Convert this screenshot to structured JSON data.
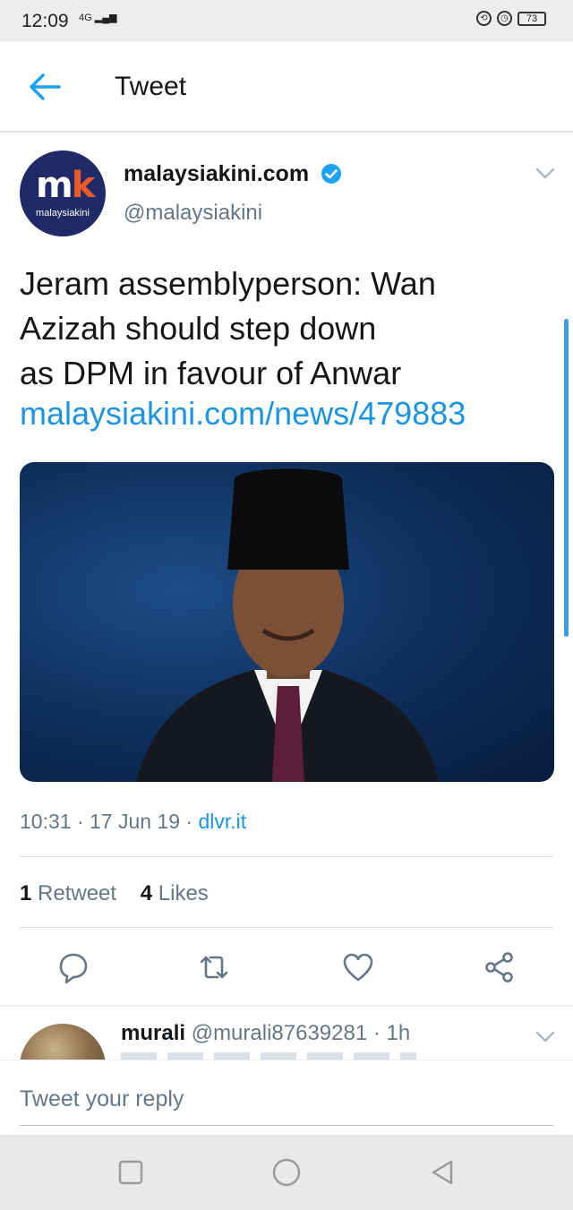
{
  "status_bar": {
    "time": "12:09",
    "network": "4G",
    "battery": "73",
    "icons": [
      "lock-rotation-icon",
      "alarm-icon"
    ]
  },
  "app_bar": {
    "title": "Tweet",
    "back_icon": "arrow-left-icon"
  },
  "tweet": {
    "display_name": "malaysiakini.com",
    "verified": true,
    "handle": "@malaysiakini",
    "avatar_text": "malaysiakini",
    "avatar_logo": {
      "m": "m",
      "k": "k"
    },
    "text_lines": [
      "Jeram assemblyperson: Wan",
      "Azizah should step down",
      "as DPM in favour of Anwar"
    ],
    "link": "malaysiakini.com/news/479883",
    "time": "10:31",
    "date": "17 Jun 19",
    "source": "dlvr.it",
    "retweets_count": "1",
    "retweets_label": "Retweet",
    "likes_count": "4",
    "likes_label": "Likes"
  },
  "actions": [
    "reply-icon",
    "retweet-icon",
    "like-icon",
    "share-icon"
  ],
  "reply": {
    "name": "murali",
    "handle": "@murali87639281",
    "time": "1h"
  },
  "reply_box": {
    "placeholder": "Tweet your reply"
  },
  "colors": {
    "accent": "#1b95e0",
    "text": "#14171a",
    "muted": "#657786",
    "avatar_bg": "#202a66"
  }
}
